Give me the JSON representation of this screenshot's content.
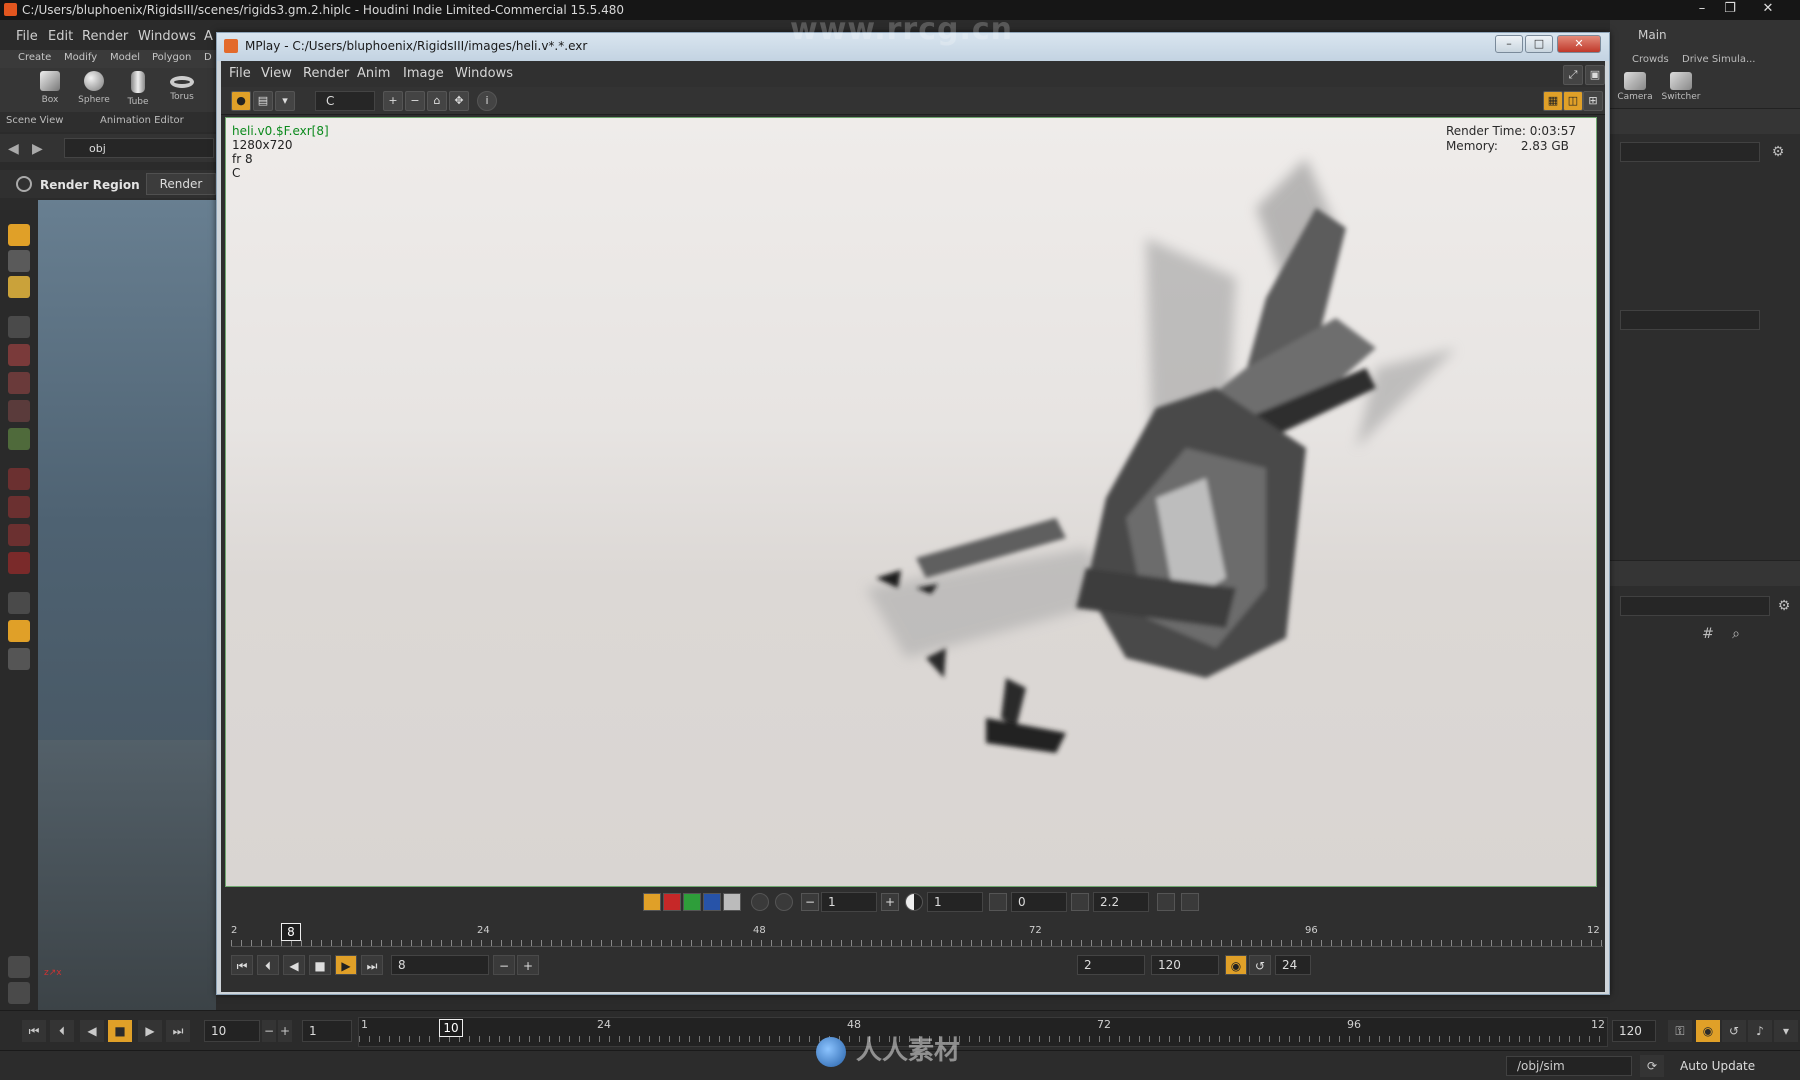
{
  "houdini": {
    "title": "C:/Users/bluphoenix/RigidsIII/scenes/rigids3.gm.2.hiplc - Houdini Indie Limited-Commercial 15.5.480",
    "menu": [
      "File",
      "Edit",
      "Render",
      "Windows",
      "A"
    ],
    "shelf_tabs": [
      "Create",
      "Modify",
      "Model",
      "Polygon",
      "D"
    ],
    "shelf_tools": [
      {
        "label": "Box",
        "icon": "box-icon"
      },
      {
        "label": "Sphere",
        "icon": "sphere-icon"
      },
      {
        "label": "Tube",
        "icon": "tube-icon"
      },
      {
        "label": "Torus",
        "icon": "torus-icon"
      }
    ],
    "pane_tabs": [
      "Scene View",
      "Animation Editor"
    ],
    "path": "obj",
    "render_region_label": "Render Region",
    "render_button": "Render",
    "right_desktop": "Main",
    "right_shelf_tabs": [
      "Crowds",
      "Drive Simula..."
    ],
    "right_tools": [
      {
        "label": "Camera",
        "icon": "camera-icon"
      },
      {
        "label": "Switcher",
        "icon": "switcher-icon"
      }
    ],
    "timeline": {
      "current_frame": "10",
      "start_field": "10",
      "step_field": "1",
      "end_label": "120",
      "ticks": [
        "1",
        "24",
        "48",
        "72",
        "96",
        "12"
      ],
      "marker": "10"
    },
    "status": {
      "network_path": "/obj/sim",
      "auto_update": "Auto Update"
    }
  },
  "mplay": {
    "title": "MPlay - C:/Users/bluphoenix/RigidsIII/images/heli.v*.*.exr",
    "menu": [
      "File",
      "View",
      "Render",
      "Anim",
      "Image",
      "Windows"
    ],
    "channel": "C",
    "image_info": {
      "filename": "heli.v0.$F.exr[8]",
      "resolution": "1280x720",
      "frame": "fr 8",
      "plane": "C"
    },
    "stats": {
      "render_time_label": "Render Time:",
      "render_time": "0:03:57",
      "memory_label": "Memory:",
      "memory": "2.83 GB"
    },
    "display": {
      "zoom": "1",
      "exposure": "1",
      "offset": "0",
      "gamma": "2.2"
    },
    "timeline": {
      "marker": "8",
      "ticks": [
        "2",
        "24",
        "48",
        "72",
        "96",
        "12"
      ],
      "frame_field": "8",
      "range_start": "2",
      "range_end": "120",
      "fps": "24"
    }
  },
  "watermarks": {
    "top": "www.rrcg.cn",
    "bottom": "人人素材"
  },
  "colors": {
    "accent": "#e0a028",
    "houdini_bg": "#2b2b2b",
    "mplay_frame": "#c3d3e2",
    "filename_green": "#0b8a1d"
  }
}
